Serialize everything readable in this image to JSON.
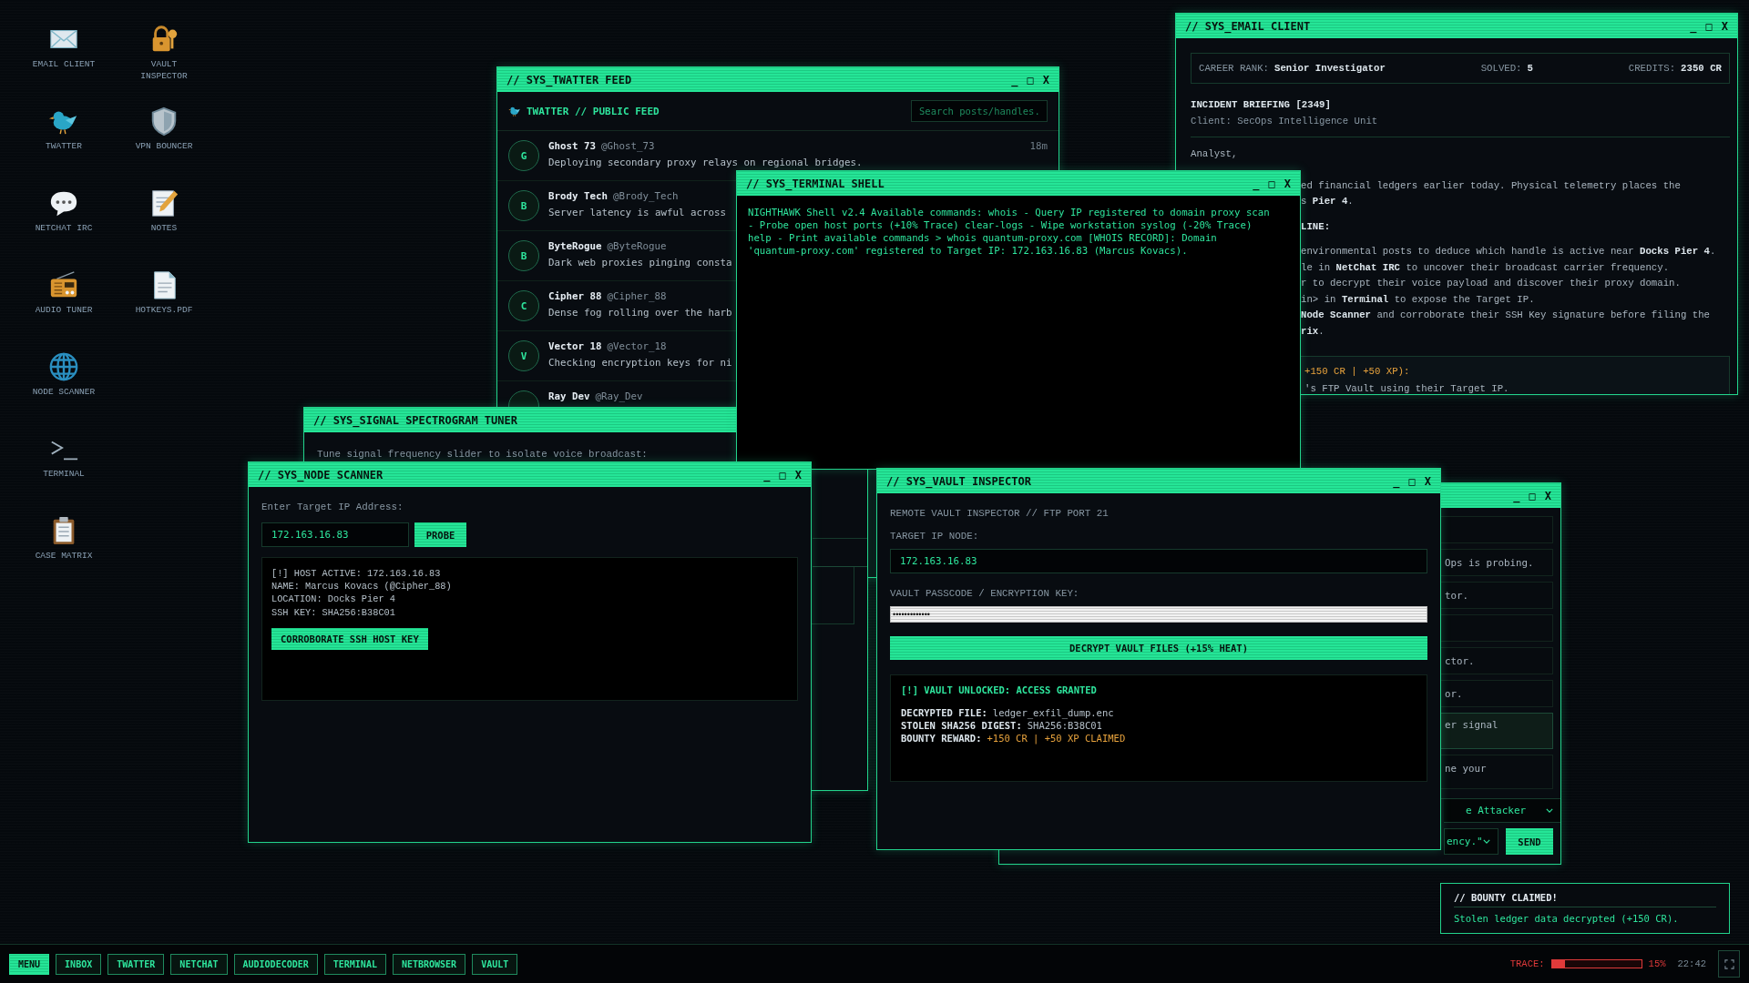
{
  "desktop": {
    "icon_columns": [
      [
        {
          "label": "EMAIL CLIENT",
          "kind": "mail"
        },
        {
          "label": "TWATTER",
          "kind": "bird"
        },
        {
          "label": "NETCHAT IRC",
          "kind": "chat"
        },
        {
          "label": "AUDIO TUNER",
          "kind": "radio"
        },
        {
          "label": "NODE SCANNER",
          "kind": "globe"
        },
        {
          "label": "TERMINAL",
          "kind": "prompt"
        },
        {
          "label": "CASE MATRIX",
          "kind": "clipboard"
        }
      ],
      [
        {
          "label": "VAULT INSPECTOR",
          "kind": "lock"
        },
        {
          "label": "VPN BOUNCER",
          "kind": "shield"
        },
        {
          "label": "NOTES",
          "kind": "notes"
        },
        {
          "label": "HOTKEYS.PDF",
          "kind": "document"
        }
      ]
    ]
  },
  "email_client": {
    "title": "// SYS_EMAIL CLIENT",
    "controls": [
      "_",
      "□",
      "X"
    ],
    "stats": [
      {
        "label": "CAREER RANK:",
        "value": "Senior Investigator"
      },
      {
        "label": "SOLVED:",
        "value": "5"
      },
      {
        "label": "CREDITS:",
        "value": "2350 CR"
      }
    ],
    "subject": "INCIDENT BRIEFING [2349]",
    "client": "Client: SecOps Intelligence Unit",
    "greeting": "Analyst,",
    "body": [
      {
        "kind": "para",
        "lines": [
          "ed financial ledgers earlier today. Physical telemetry places the",
          "s **Pier 4**."
        ]
      },
      {
        "kind": "heading",
        "lines": [
          "LINE:"
        ]
      },
      {
        "kind": "list",
        "lines": [
          "environmental posts to deduce which handle is active near **Docks Pier 4**.",
          "le in **NetChat IRC** to uncover their broadcast carrier frequency.",
          "r to decrypt their voice payload and discover their proxy domain.",
          "in> in **Terminal** to expose the Target IP.",
          "**Node Scanner** and corroborate their SSH Key signature before filing the",
          "**rix**."
        ]
      }
    ],
    "reward": {
      "title": "+150 CR | +50 XP):",
      "text": "'s FTP Vault using their Target IP."
    }
  },
  "twatter_feed": {
    "title": "// SYS_TWATTER FEED",
    "controls": [
      "_",
      "□",
      "X"
    ],
    "header": "TWATTER // PUBLIC FEED",
    "search": {
      "placeholder": "Search posts/handles."
    },
    "posts": [
      {
        "avatar": "G",
        "name": "Ghost 73",
        "handle": "@Ghost_73",
        "time": "18m",
        "text": "Deploying secondary proxy relays on regional bridges."
      },
      {
        "avatar": "B",
        "name": "Brody Tech",
        "handle": "@Brody_Tech",
        "text": "Server latency is awful across"
      },
      {
        "avatar": "B",
        "name": "ByteRogue",
        "handle": "@ByteRogue",
        "text": "Dark web proxies pinging consta"
      },
      {
        "avatar": "C",
        "name": "Cipher 88",
        "handle": "@Cipher_88",
        "text": "Dense fog rolling over the harb"
      },
      {
        "avatar": "V",
        "name": "Vector 18",
        "handle": "@Vector_18",
        "text": "Checking encryption keys for ni"
      },
      {
        "name": "Ray Dev",
        "handle": "@Ray_Dev"
      }
    ]
  },
  "netchat": {
    "controls": [
      "_",
      "□",
      "X"
    ],
    "messages": [
      {
        "highlighted": false
      },
      {
        "text": "Ops is probing.",
        "highlighted": false
      },
      {
        "text": "tor.",
        "highlighted": false
      },
      {
        "highlighted": false
      },
      {
        "text": "ctor.",
        "highlighted": false
      },
      {
        "text": "or.",
        "highlighted": false
      },
      {
        "text": "er signal",
        "highlighted": true
      },
      {
        "text": "ne your",
        "highlighted": false
      }
    ],
    "target_select": "e Attacker",
    "message_select": "ency.\"",
    "send": "SEND"
  },
  "spectrogram_tuner": {
    "title": "// SYS_SIGNAL SPECTROGRAM TUNER",
    "instruction": "Tune signal frequency slider to isolate voice broadcast:"
  },
  "terminal_shell": {
    "title": "// SYS_TERMINAL SHELL",
    "controls": [
      "_",
      "□",
      "X"
    ],
    "output": "NIGHTHAWK Shell v2.4 Available commands: whois - Query IP registered to domain proxy scan - Probe open host ports (+10% Trace) clear-logs - Wipe workstation syslog (-20% Trace) help - Print available commands > whois quantum-proxy.com [WHOIS RECORD]: Domain 'quantum-proxy.com' registered to Target IP: 172.163.16.83 (Marcus Kovacs)."
  },
  "node_scanner": {
    "title": "// SYS_NODE SCANNER",
    "controls": [
      "_",
      "□",
      "X"
    ],
    "label": "Enter Target IP Address:",
    "ip": "172.163.16.83",
    "probe": "PROBE",
    "result": [
      "[!] HOST ACTIVE: 172.163.16.83",
      "NAME: Marcus Kovacs (@Cipher_88)",
      "LOCATION: Docks Pier 4",
      "SSH KEY: SHA256:B38C01"
    ],
    "action": "CORROBORATE SSH HOST KEY"
  },
  "vault_inspector": {
    "title": "// SYS_VAULT INSPECTOR",
    "controls": [
      "_",
      "□",
      "X"
    ],
    "header": "REMOTE VAULT INSPECTOR // FTP PORT 21",
    "ip_label": "TARGET IP NODE:",
    "ip": "172.163.16.83",
    "key_label": "VAULT PASSCODE / ENCRYPTION KEY:",
    "key": "•••••••••••••",
    "decrypt": "DECRYPT VAULT FILES (+15% HEAT)",
    "status": "[!] VAULT UNLOCKED: ACCESS GRANTED",
    "fields": [
      {
        "label": "DECRYPTED FILE:",
        "value": "ledger_exfil_dump.enc",
        "kind": "normal"
      },
      {
        "label": "STOLEN SHA256 DIGEST:",
        "value": "SHA256:B38C01",
        "kind": "normal"
      },
      {
        "label": "BOUNTY REWARD:",
        "value": "+150 CR | +50 XP CLAIMED",
        "kind": "reward"
      }
    ]
  },
  "toast": {
    "title": "// BOUNTY CLAIMED!",
    "text": "Stolen ledger data decrypted (+150 CR)."
  },
  "taskbar": {
    "items": [
      {
        "label": "MENU",
        "selected": true
      },
      {
        "label": "INBOX",
        "selected": false
      },
      {
        "label": "TWATTER",
        "selected": false
      },
      {
        "label": "NETCHAT",
        "selected": false
      },
      {
        "label": "AUDIODECODER",
        "selected": false
      },
      {
        "label": "TERMINAL",
        "selected": false
      },
      {
        "label": "NETBROWSER",
        "selected": false
      },
      {
        "label": "VAULT",
        "selected": false
      }
    ],
    "trace": {
      "label": "TRACE:",
      "level": 0.15,
      "reading": "15%"
    },
    "clock": "22:42"
  }
}
